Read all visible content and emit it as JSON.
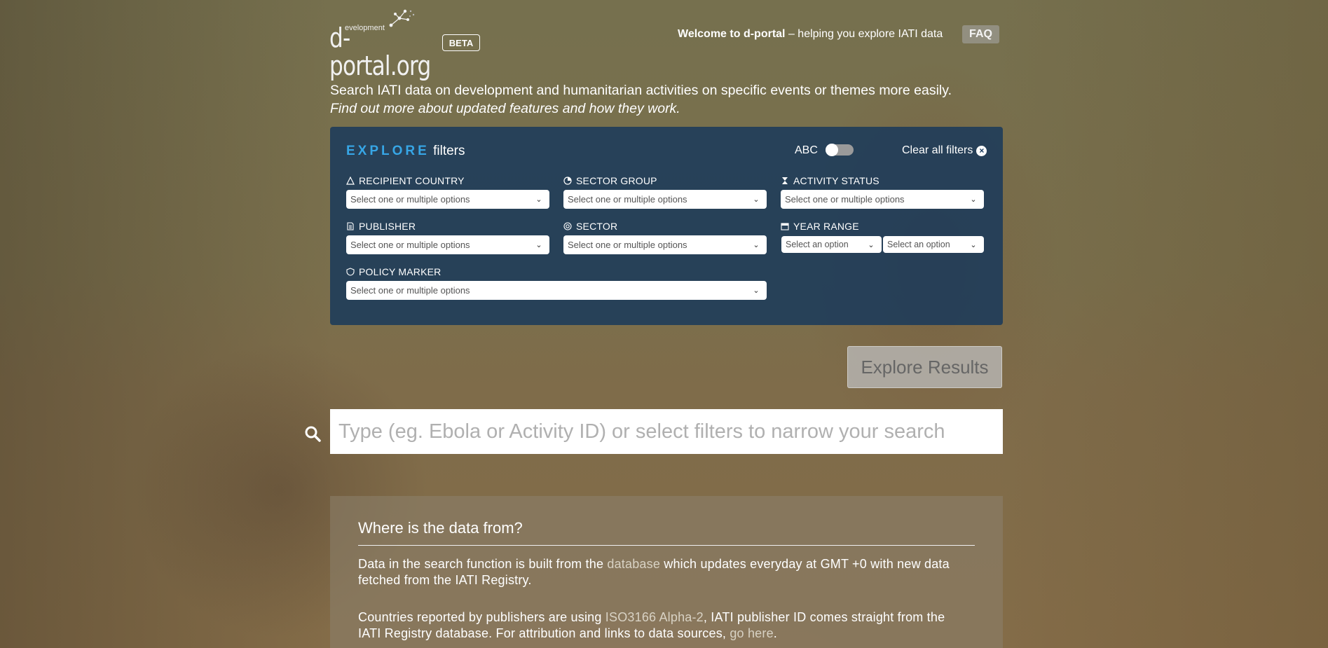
{
  "header": {
    "logo": {
      "small": "evelopment",
      "main": "d-portal.org"
    },
    "beta_label": "BETA",
    "welcome_bold": "Welcome to d-portal",
    "welcome_rest": " – helping you explore IATI data",
    "faq_label": "FAQ"
  },
  "intro": {
    "line1": "Search IATI data on development and humanitarian activities on specific events or themes more easily.",
    "line2": "Find out more about updated features and how they work."
  },
  "explore": {
    "title_word": "EXPLORE",
    "title_rest": " filters",
    "abc_label": "ABC",
    "toggle_on": false,
    "clear_label": "Clear all filters",
    "filters": {
      "recipient_country": {
        "label": "RECIPIENT COUNTRY",
        "placeholder": "Select one or multiple options",
        "icon": "triangle-icon"
      },
      "sector_group": {
        "label": "SECTOR GROUP",
        "placeholder": "Select one or multiple options",
        "icon": "pie-icon"
      },
      "activity_status": {
        "label": "ACTIVITY STATUS",
        "placeholder": "Select one or multiple options",
        "icon": "hourglass-icon"
      },
      "publisher": {
        "label": "PUBLISHER",
        "placeholder": "Select one or multiple options",
        "icon": "document-icon"
      },
      "sector": {
        "label": "SECTOR",
        "placeholder": "Select one or multiple options",
        "icon": "target-icon"
      },
      "year_range": {
        "label": "YEAR RANGE",
        "from_placeholder": "Select an option",
        "to_placeholder": "Select an option",
        "icon": "calendar-icon"
      },
      "policy_marker": {
        "label": "POLICY MARKER",
        "placeholder": "Select one or multiple options",
        "icon": "shield-icon"
      }
    },
    "results_button": "Explore Results"
  },
  "search": {
    "placeholder": "Type (eg. Ebola or Activity ID) or select filters to narrow your search"
  },
  "info": {
    "title": "Where is the data from?",
    "p1_a": "Data in the search function is built from the ",
    "p1_link": "database",
    "p1_b": " which updates everyday at GMT +0 with new data fetched from the IATI Registry.",
    "p2_a": "Countries reported by publishers are using ",
    "p2_link1": "ISO3166 Alpha-2",
    "p2_b": ", IATI publisher ID comes straight from the IATI Registry database. For attribution and links to data sources, ",
    "p2_link2": "go here",
    "p2_c": "."
  }
}
